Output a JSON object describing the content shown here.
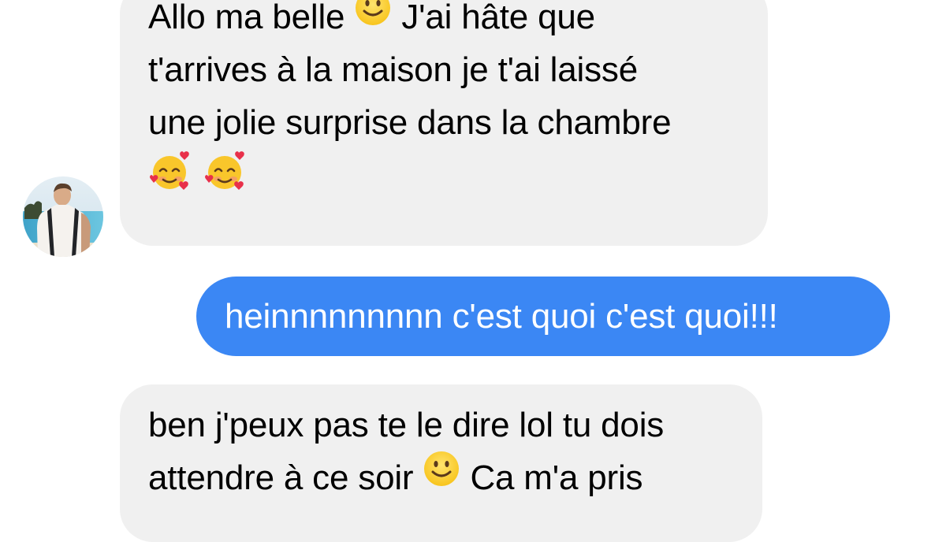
{
  "conversation": {
    "messages": [
      {
        "sender": "contact",
        "lines": [
          [
            "Allo ma belle",
            "slightly-smiling-face",
            "J'ai hâte que"
          ],
          [
            "t'arrives à la maison je t'ai laissé"
          ],
          [
            "une jolie surprise dans la chambre"
          ],
          [
            "smiling-face-with-hearts",
            "smiling-face-with-hearts"
          ]
        ],
        "line1_a": "Allo ma belle",
        "line1_b": "J'ai hâte que",
        "line2": "t'arrives à la maison je t'ai laissé",
        "line3": "une jolie surprise dans la chambre"
      },
      {
        "sender": "me",
        "text": "heinnnnnnnnn c'est quoi c'est quoi!!!"
      },
      {
        "sender": "contact",
        "line1": "ben j'peux pas te le dire lol tu dois",
        "line2_a": "attendre à ce soir",
        "line2_b": "Ca m'a pris"
      }
    ]
  },
  "icons": {
    "smile": "slightly-smiling-face-icon",
    "hearts": "smiling-face-with-hearts-icon",
    "avatar": "contact-avatar"
  },
  "colors": {
    "incoming_bubble": "#f0f0f0",
    "outgoing_bubble": "#3b87f4",
    "outgoing_text": "#ffffff",
    "incoming_text": "#000000"
  }
}
